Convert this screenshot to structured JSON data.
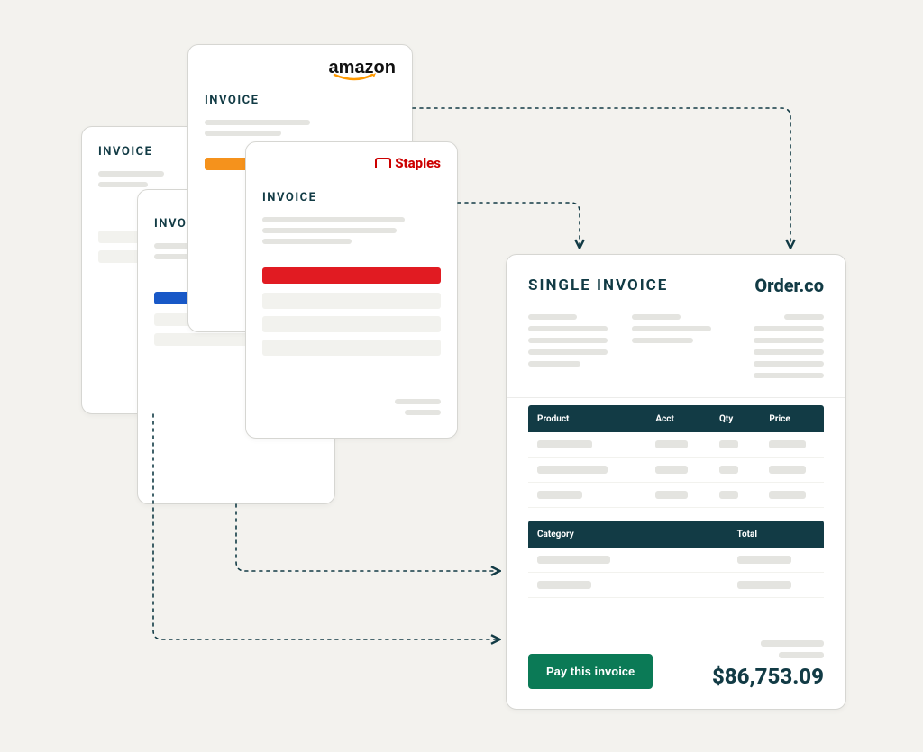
{
  "source_cards": {
    "yellow": {
      "title": "INVOICE",
      "accent": "#f5c518"
    },
    "blue": {
      "title": "INVOICE",
      "accent": "#1858c7"
    },
    "amazon": {
      "title": "INVOICE",
      "accent": "#f5921c",
      "logo_text": "amazon"
    },
    "staples": {
      "title": "INVOICE",
      "accent": "#e11b22",
      "logo_text": "Staples"
    }
  },
  "single": {
    "title": "SINGLE INVOICE",
    "brand": "Order.co",
    "table1_headers": {
      "product": "Product",
      "acct": "Acct",
      "qty": "Qty",
      "price": "Price"
    },
    "table2_headers": {
      "category": "Category",
      "total": "Total"
    },
    "pay_button": "Pay this invoice",
    "total_amount": "$86,753.09"
  },
  "colors": {
    "brand_dark": "#123b45",
    "pay_green": "#0b7a56"
  }
}
